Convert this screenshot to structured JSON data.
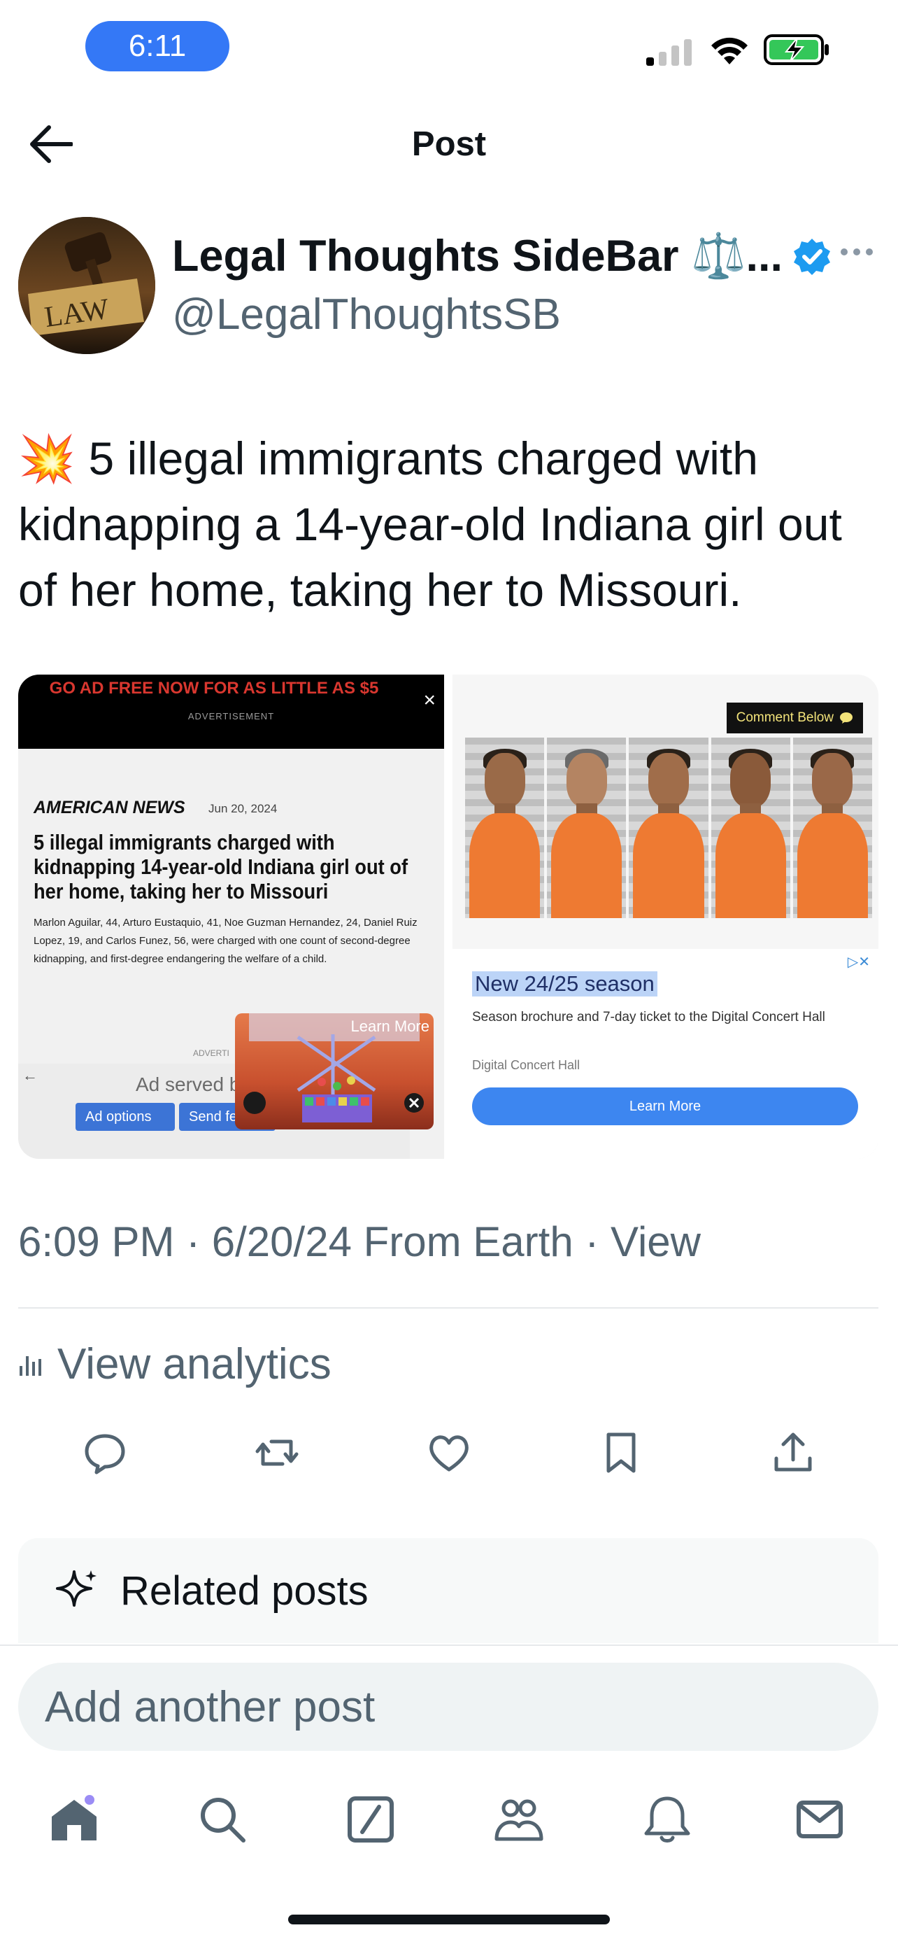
{
  "status_bar": {
    "time": "6:11"
  },
  "header": {
    "title": "Post"
  },
  "author": {
    "display_name": "Legal Thoughts SideBar ⚖️...",
    "handle": "@LegalThoughtsSB",
    "avatar_text": "LAW",
    "verified": true
  },
  "post": {
    "emoji": "💥",
    "text": "5 illegal immigrants charged with kidnapping a 14-year-old Indiana girl out of her home, taking her to Missouri.",
    "meta": "6:09 PM · 6/20/24 From Earth · View"
  },
  "media": {
    "left": {
      "promo": "GO AD FREE NOW FOR AS LITTLE AS $5",
      "ad_label": "ADVERTISEMENT",
      "close": "×",
      "source": "AMERICAN NEWS",
      "date": "Jun 20, 2024",
      "headline": "5 illegal immigrants charged with kidnapping 14-year-old Indiana girl out of her home, taking her to Missouri",
      "body": "Marlon Aguilar, 44, Arturo Eustaquio, 41, Noe Guzman Hernandez, 24, Daniel Ruiz Lopez, 19, and Carlos Funez, 56, were charged with one count of second-degree kidnapping, and first-degree endangering the welfare of a child.",
      "mini_label": "ADVERTI",
      "ad_served": "Ad served b",
      "ad_options": "Ad options",
      "send_feedback": "Send feedb",
      "video_learn_more": "Learn More"
    },
    "right": {
      "comment_chip": "Comment Below",
      "ad_title": "New 24/25 season",
      "ad_desc": "Season brochure and 7-day ticket to the Digital Concert Hall",
      "ad_source": "Digital Concert Hall",
      "ad_button": "Learn More"
    }
  },
  "analytics": {
    "label": "View analytics"
  },
  "related": {
    "label": "Related posts"
  },
  "composer": {
    "placeholder": "Add another post"
  },
  "colors": {
    "accent": "#1d9bf0",
    "time_pill": "#3478f6",
    "secondary_text": "#536471"
  }
}
